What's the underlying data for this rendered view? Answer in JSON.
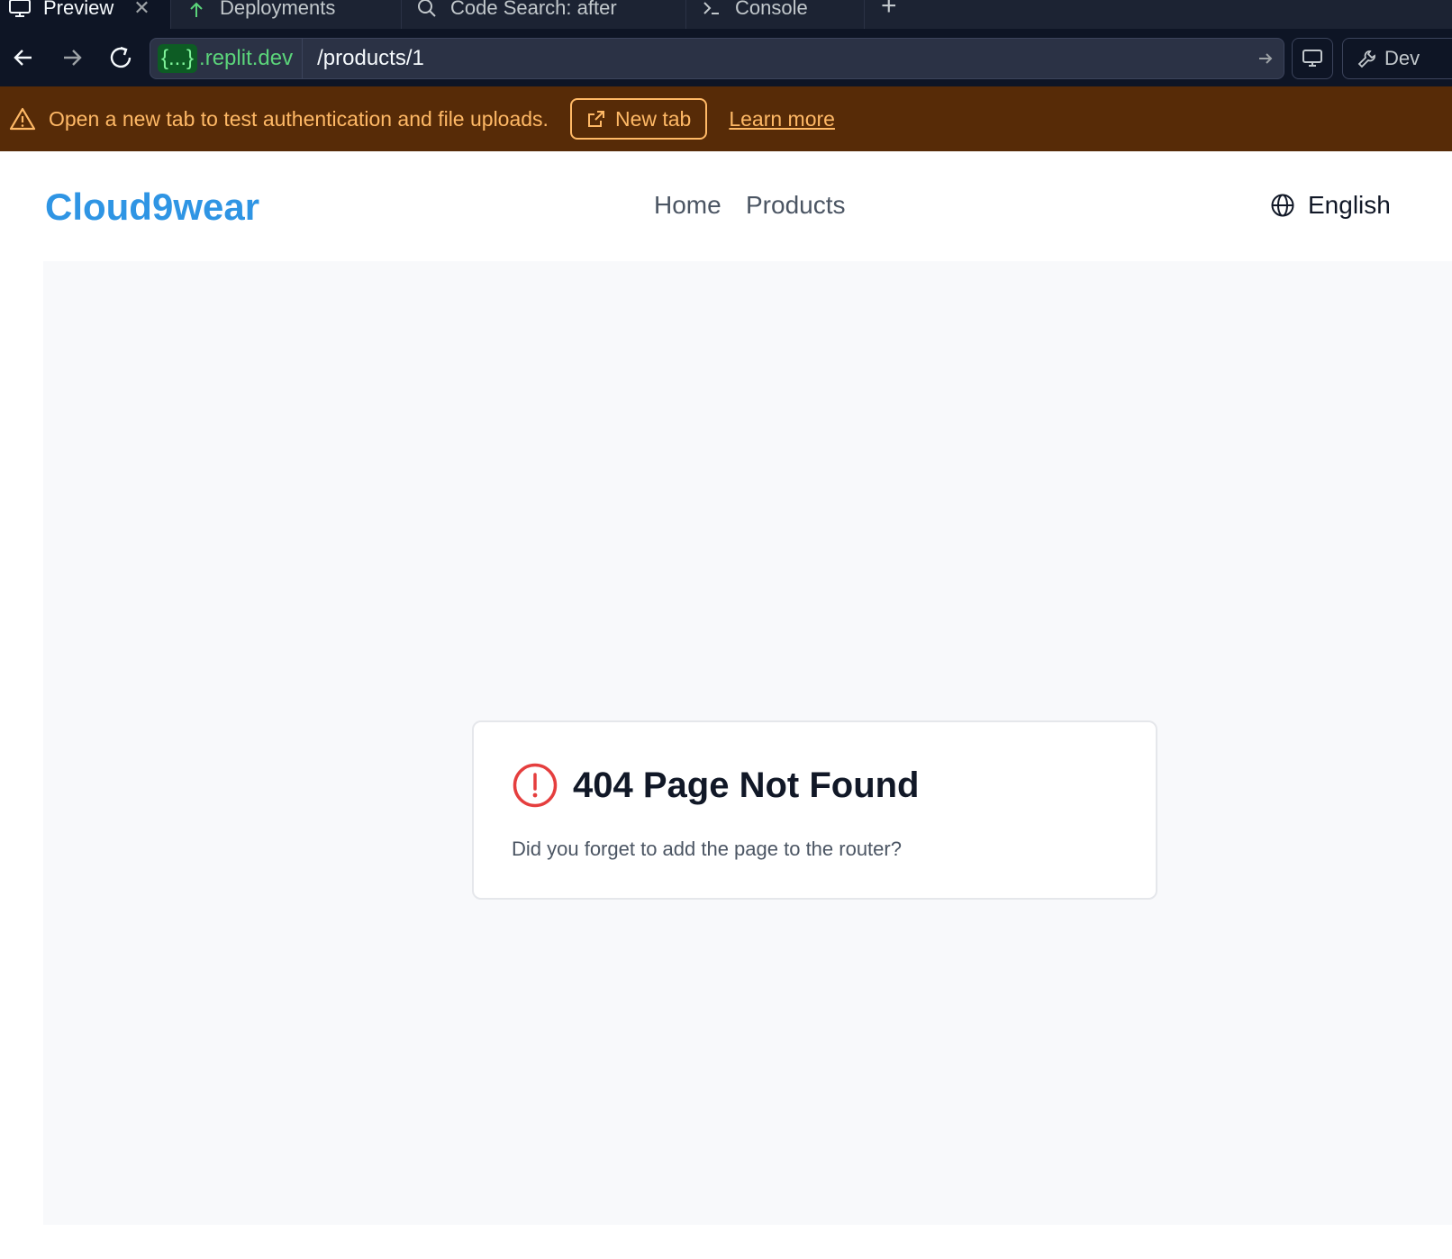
{
  "tabs": [
    {
      "label": "Preview",
      "icon": "monitor-icon",
      "active": true,
      "closable": true
    },
    {
      "label": "Deployments",
      "icon": "deployments-icon",
      "active": false
    },
    {
      "label": "Code Search: after",
      "icon": "search-icon",
      "active": false
    },
    {
      "label": "Console",
      "icon": "terminal-icon",
      "active": false
    }
  ],
  "address_bar": {
    "host_badge": "{...}",
    "host": ".replit.dev",
    "path": "/products/1",
    "devtools_label": "Dev"
  },
  "banner": {
    "message": "Open a new tab to test authentication and file uploads.",
    "new_tab_label": "New tab",
    "learn_more_label": "Learn more",
    "background": "#572b07",
    "color": "#ffb966"
  },
  "site": {
    "logo": "Cloud9wear",
    "nav": {
      "home": "Home",
      "products": "Products"
    },
    "language": "English",
    "brand_color": "#2f95e4"
  },
  "error_card": {
    "title": "404 Page Not Found",
    "description": "Did you forget to add the page to the router?",
    "icon": "alert-circle-icon",
    "icon_color": "#e53e3e"
  }
}
